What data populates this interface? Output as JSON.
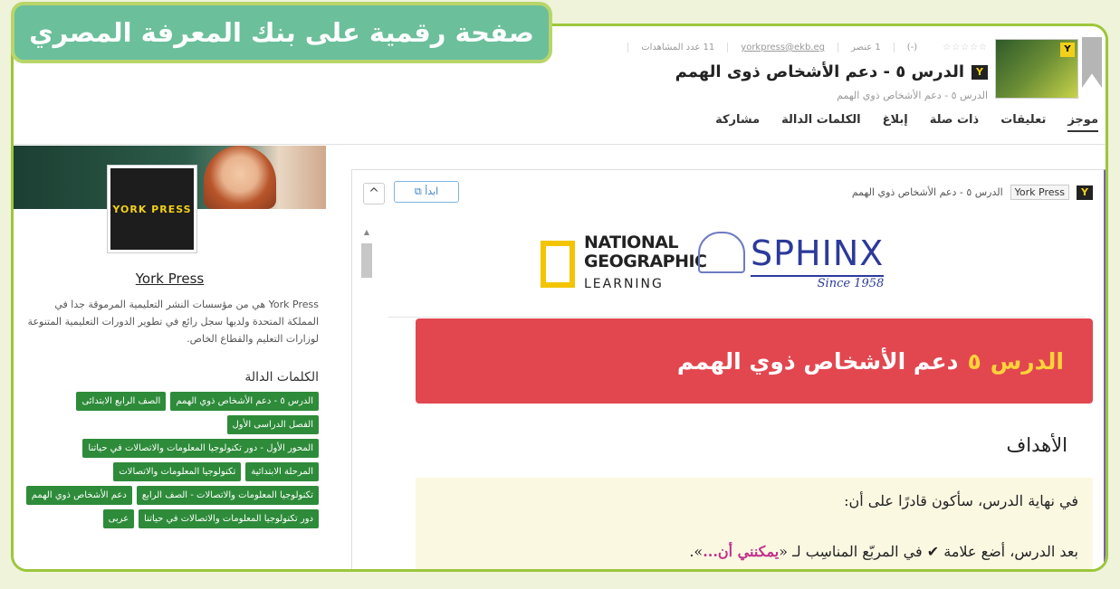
{
  "banner": "صفحة رقمية على بنك المعرفة المصري",
  "header": {
    "stars": "☆☆☆☆☆",
    "rating_count": "(-)",
    "items": "1 عنصر",
    "email": "yorkpress@ekb.eg",
    "views": "11 عدد المشاهدات",
    "title": "الدرس ٥ - دعم الأشخاص ذوى الهمم",
    "subtitle": "الدرس ٥ - دعم الأشخاص ذوي الهمم",
    "badge": "Y"
  },
  "tabs": [
    "موجز",
    "تعليقات",
    "ذات صلة",
    "إبلاغ",
    "الكلمات الدالة",
    "مشاركة"
  ],
  "sidebar": {
    "logo_text": "YORK PRESS",
    "publisher_name": "York Press",
    "description": "York Press هي من مؤسسات النشر التعليمية المرموقة جدا في المملكة المتحدة ولديها سجل رائع في تطوير الدورات التعليمية المتنوعة لوزارات التعليم والقطاع الخاص.",
    "keywords_title": "الكلمات الدالة",
    "keywords": [
      "الدرس ٥ - دعم الأشخاص ذوي الهمم",
      "الصف الرابع الابتدائى",
      "الفصل الدراسى الأول",
      "المحور الأول - دور تكنولوجيا المعلومات والاتصالات في حياتنا",
      "المرحلة الابتدائية",
      "تكنولوجيا المعلومات والاتصالات",
      "تكنولوجيا المعلومات والاتصالات - الصف الرابع",
      "دعم الأشخاص ذوي الهمم",
      "دور تكنولوجيا المعلومات والاتصالات في حياتنا",
      "عربى"
    ]
  },
  "viewer": {
    "publisher_tag": "York Press",
    "doc_title": "الدرس ٥ - دعم الأشخاص ذوي الهمم",
    "start_button": "ابدأ ⧉",
    "chevron": "^",
    "natgeo_lines": [
      "NATIONAL",
      "GEOGRAPHIC",
      "LEARNING"
    ],
    "sphinx": "SPHINX",
    "sphinx_since": "Since 1958",
    "lesson_label": "الدرس",
    "lesson_number": "٥",
    "lesson_title": "دعم الأشخاص ذوي الهمم",
    "goals_title": "الأهداف",
    "goal_line1": "في نهاية الدرس، سأكون قادرًا على أن:",
    "goal_line2_pre": "بعد الدرس، أضع علامة ✔ في المربّع المناسِب لـ «",
    "goal_line2_pink": "يمكنني أن...",
    "goal_line2_post": "»."
  }
}
